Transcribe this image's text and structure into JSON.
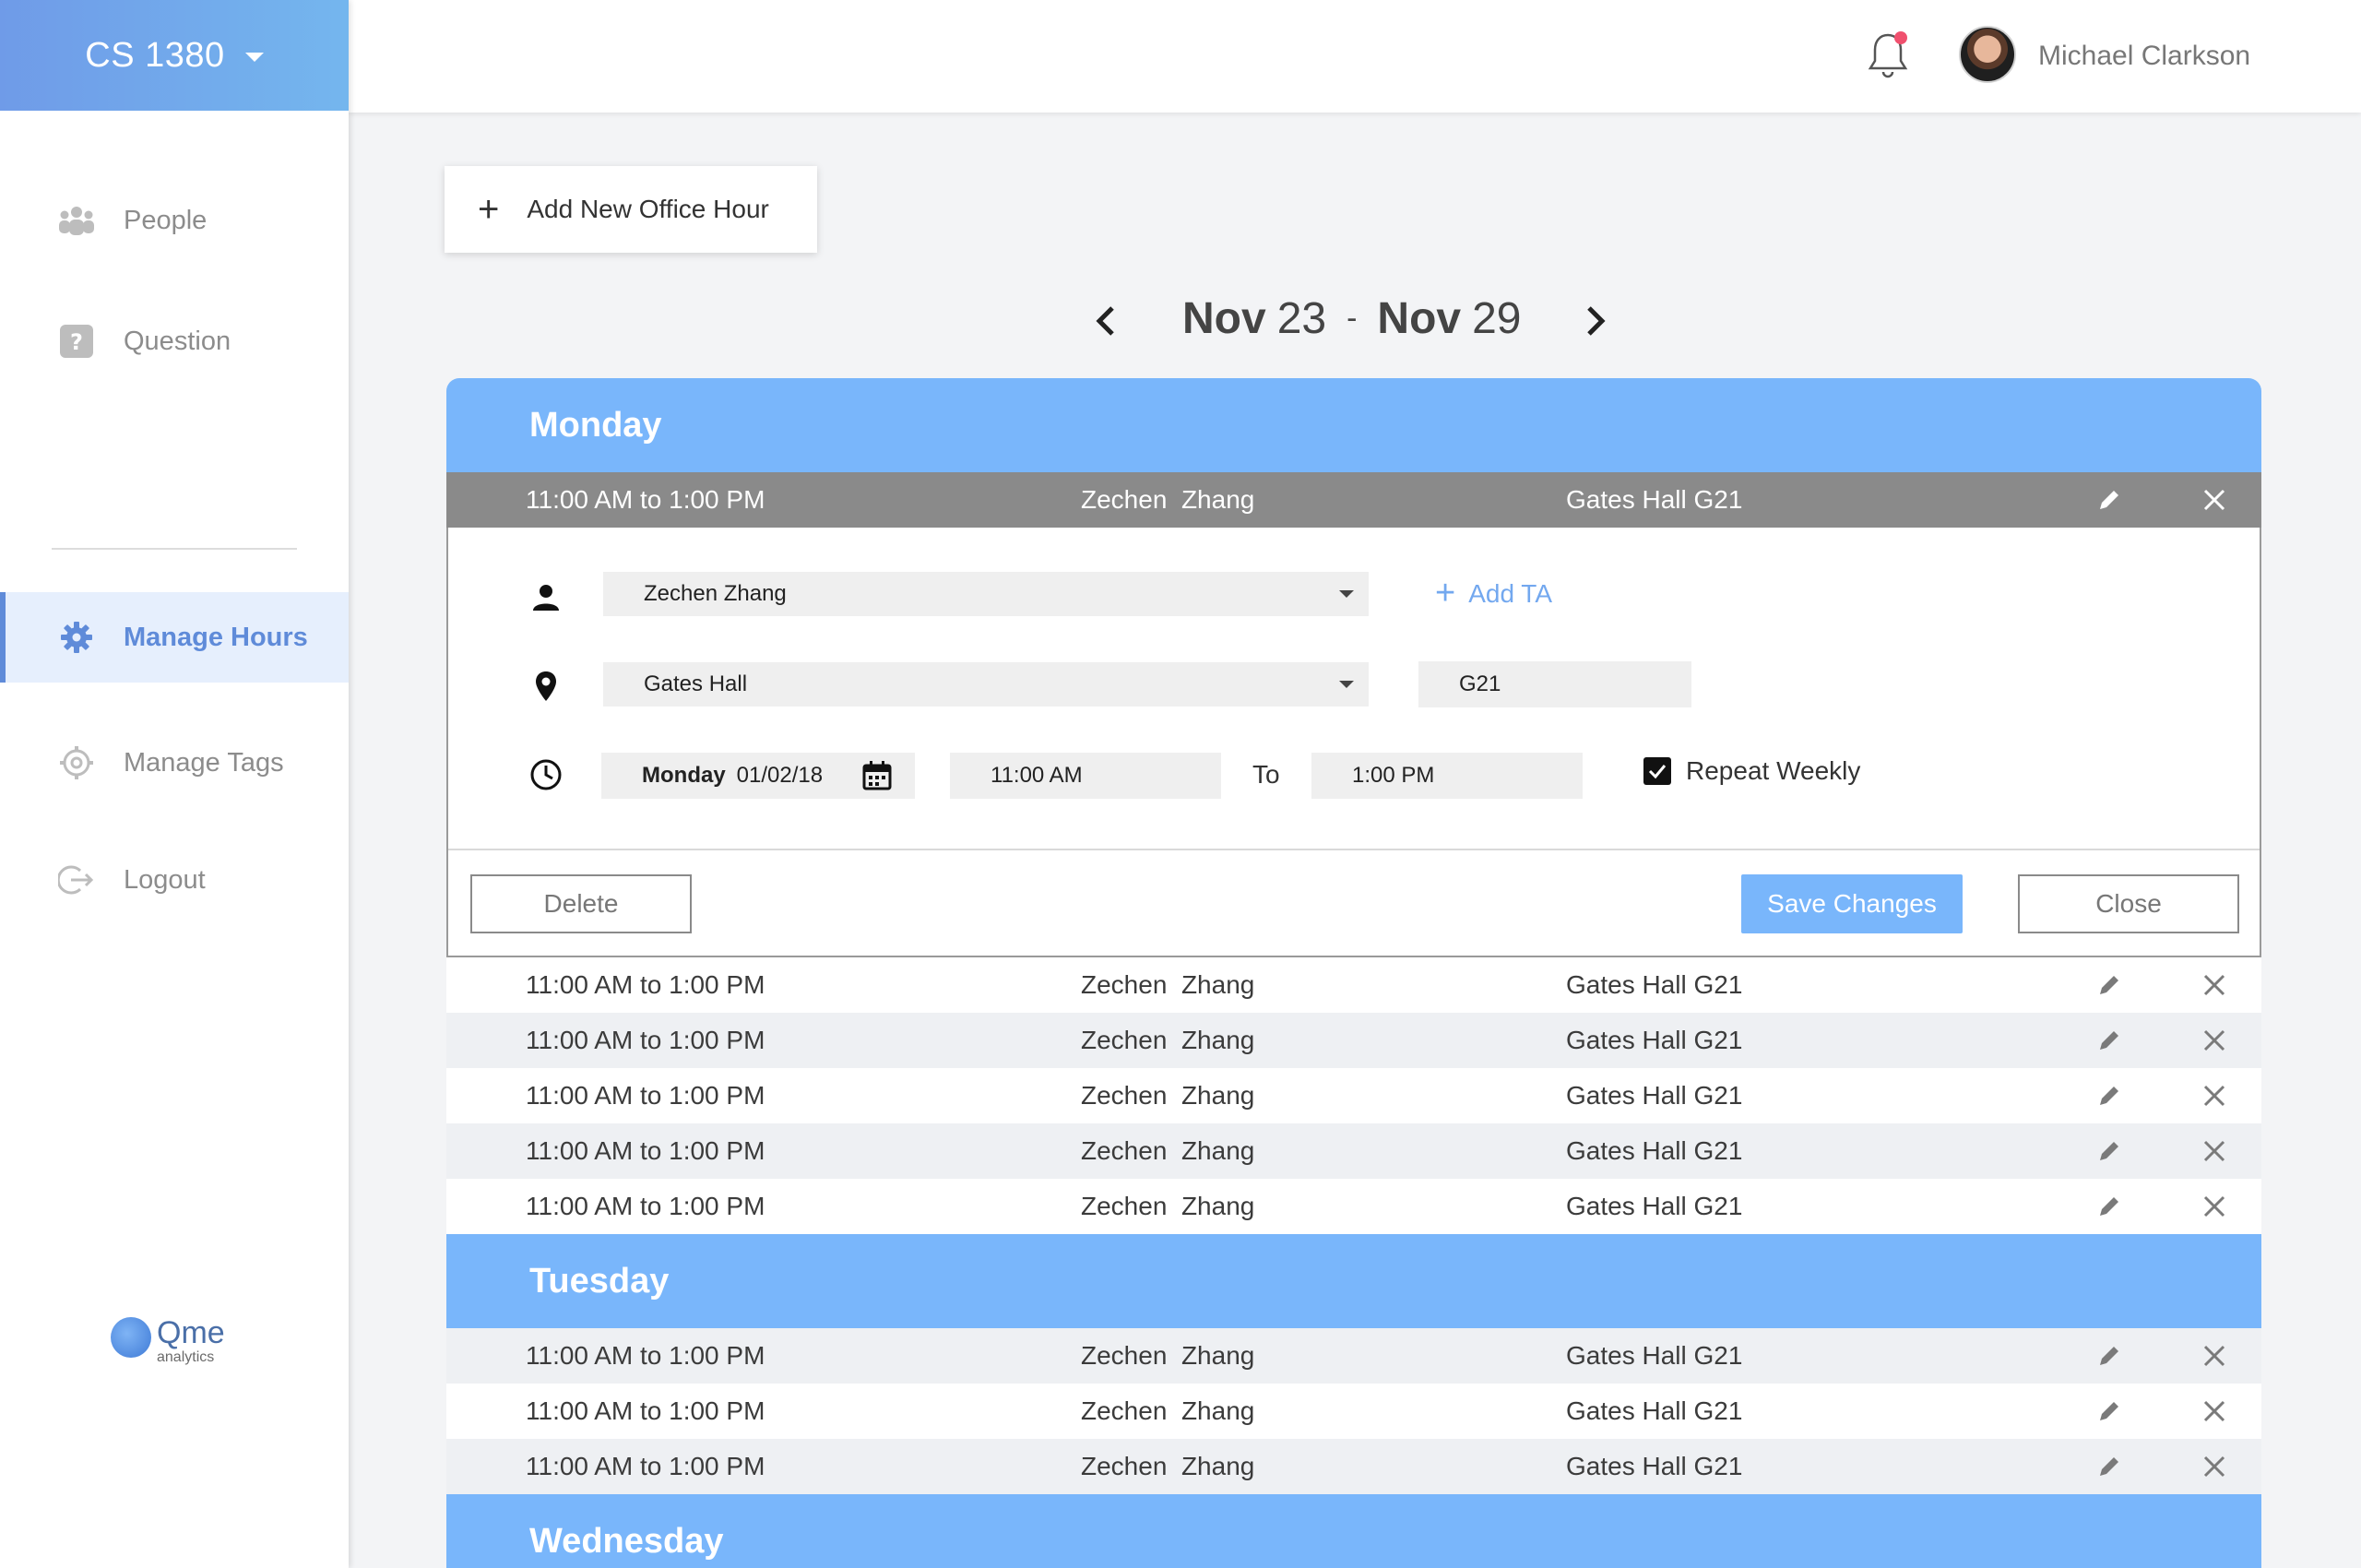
{
  "sidebar": {
    "course": "CS 1380",
    "items": [
      {
        "label": "People",
        "icon": "people-icon"
      },
      {
        "label": "Question",
        "icon": "question-icon"
      },
      {
        "label": "Manage Hours",
        "icon": "gear-icon",
        "active": true
      },
      {
        "label": "Manage Tags",
        "icon": "tag-gear-icon"
      },
      {
        "label": "Logout",
        "icon": "logout-icon"
      }
    ],
    "brand": {
      "name": "Qme",
      "sub": "analytics"
    }
  },
  "header": {
    "username": "Michael Clarkson"
  },
  "main": {
    "add_button": "Add New Office Hour",
    "week": {
      "start_month": "Nov",
      "start_day": "23",
      "separator": "-",
      "end_month": "Nov",
      "end_day": "29"
    },
    "days": [
      {
        "name": "Monday",
        "rows": [
          {
            "time": "11:00 AM to 1:00 PM",
            "ta": "Zechen  Zhang",
            "location": "Gates Hall G21"
          },
          {
            "time": "11:00 AM to 1:00 PM",
            "ta": "Zechen  Zhang",
            "location": "Gates Hall G21"
          },
          {
            "time": "11:00 AM to 1:00 PM",
            "ta": "Zechen  Zhang",
            "location": "Gates Hall G21"
          },
          {
            "time": "11:00 AM to 1:00 PM",
            "ta": "Zechen  Zhang",
            "location": "Gates Hall G21"
          },
          {
            "time": "11:00 AM to 1:00 PM",
            "ta": "Zechen  Zhang",
            "location": "Gates Hall G21"
          },
          {
            "time": "11:00 AM to 1:00 PM",
            "ta": "Zechen  Zhang",
            "location": "Gates Hall G21"
          }
        ]
      },
      {
        "name": "Tuesday",
        "rows": [
          {
            "time": "11:00 AM to 1:00 PM",
            "ta": "Zechen  Zhang",
            "location": "Gates Hall G21"
          },
          {
            "time": "11:00 AM to 1:00 PM",
            "ta": "Zechen  Zhang",
            "location": "Gates Hall G21"
          },
          {
            "time": "11:00 AM to 1:00 PM",
            "ta": "Zechen  Zhang",
            "location": "Gates Hall G21"
          }
        ]
      },
      {
        "name": "Wednesday",
        "rows": []
      }
    ],
    "editor": {
      "ta_select": "Zechen Zhang",
      "add_ta": "Add TA",
      "building_select": "Gates Hall",
      "room": "G21",
      "date_day": "Monday",
      "date_value": "01/02/18",
      "start_time": "11:00 AM",
      "to_label": "To",
      "end_time": "1:00 PM",
      "repeat_label": "Repeat Weekly",
      "repeat_checked": true,
      "delete": "Delete",
      "save": "Save Changes",
      "close": "Close"
    }
  },
  "colors": {
    "accent": "#79b6fb",
    "active_nav": "#5f8bd9",
    "selected_row": "#8a8a8a",
    "badge": "#f0506e"
  }
}
